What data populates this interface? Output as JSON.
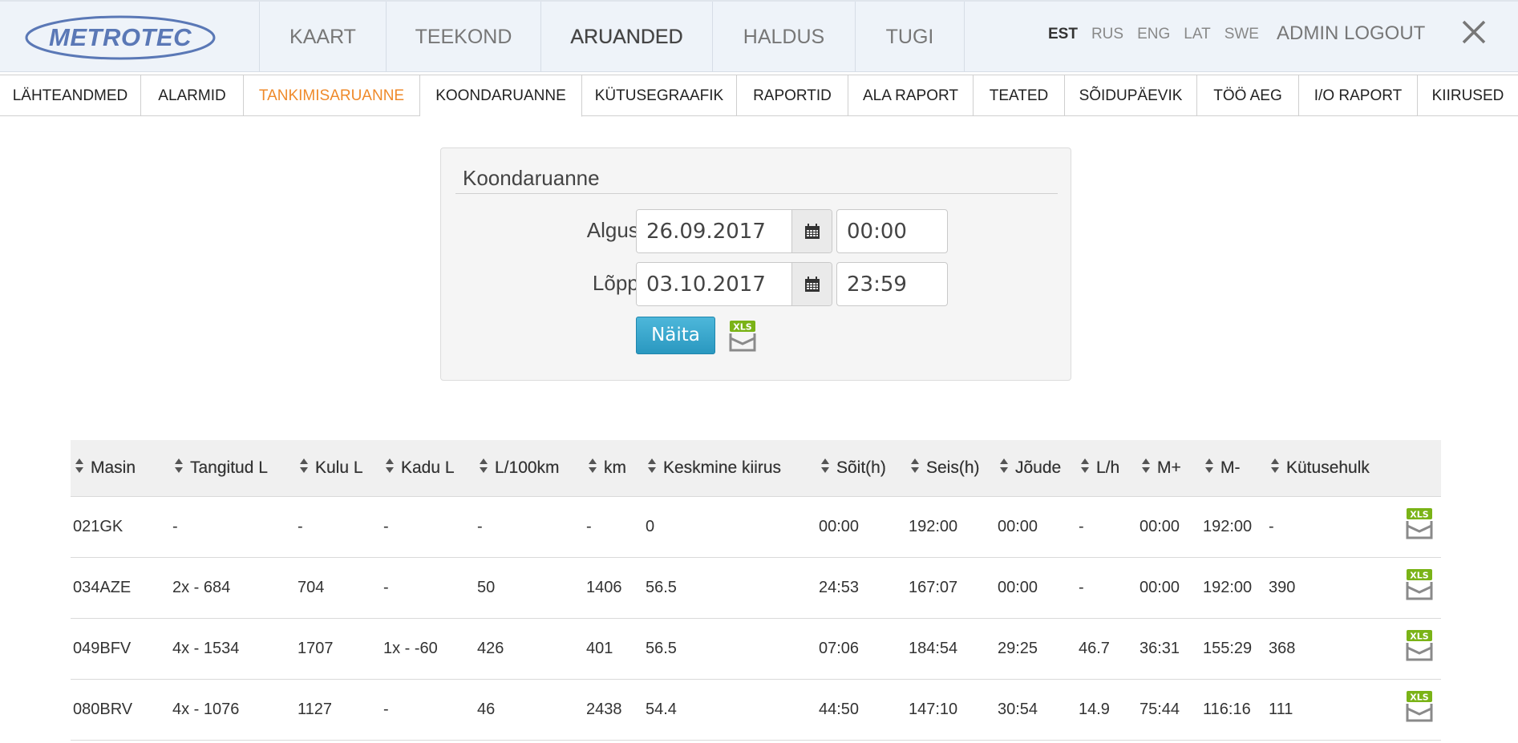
{
  "header": {
    "logo": "METROTEC",
    "nav": [
      "KAART",
      "TEEKOND",
      "ARUANDED",
      "HALDUS",
      "TUGI"
    ],
    "active_nav": "ARUANDED",
    "languages": [
      "EST",
      "RUS",
      "ENG",
      "LAT",
      "SWE"
    ],
    "active_language": "EST",
    "logout_label": "ADMIN LOGOUT",
    "close_icon": "close-icon"
  },
  "subtabs": [
    "LÄHTEANDMED",
    "ALARMID",
    "TANKIMISARUANNE",
    "KOONDARUANNE",
    "KÜTUSEGRAAFIK",
    "RAPORTID",
    "ALA RAPORT",
    "TEATED",
    "SÕIDUPÄEVIK",
    "TÖÖ AEG",
    "I/O RAPORT",
    "KIIRUSED"
  ],
  "active_subtab": "KOONDARUANNE",
  "highlight_subtab": "TANKIMISARUANNE",
  "report_form": {
    "title": "Koondaruanne",
    "start_label": "Algus:",
    "start_date": "26.09.2017",
    "start_time": "00:00",
    "end_label": "Lõpp:",
    "end_date": "03.10.2017",
    "end_time": "23:59",
    "show_button": "Näita",
    "xls_label": "XLS"
  },
  "table": {
    "columns": [
      "Masin",
      "Tangitud L",
      "Kulu L",
      "Kadu L",
      "L/100km",
      "km",
      "Keskmine kiirus",
      "Sõit(h)",
      "Seis(h)",
      "Jõude",
      "L/h",
      "M+",
      "M-",
      "Kütusehulk"
    ],
    "rows": [
      [
        "021GK",
        "-",
        "-",
        "-",
        "-",
        "-",
        "0",
        "00:00",
        "192:00",
        "00:00",
        "-",
        "00:00",
        "192:00",
        "-"
      ],
      [
        "034AZE",
        "2x - 684",
        "704",
        "-",
        "50",
        "1406",
        "56.5",
        "24:53",
        "167:07",
        "00:00",
        "-",
        "00:00",
        "192:00",
        "390"
      ],
      [
        "049BFV",
        "4x - 1534",
        "1707",
        "1x - -60",
        "426",
        "401",
        "56.5",
        "07:06",
        "184:54",
        "29:25",
        "46.7",
        "36:31",
        "155:29",
        "368"
      ],
      [
        "080BRV",
        "4x - 1076",
        "1127",
        "-",
        "46",
        "2438",
        "54.4",
        "44:50",
        "147:10",
        "30:54",
        "14.9",
        "75:44",
        "116:16",
        "111"
      ]
    ]
  },
  "colors": {
    "accent_orange": "#ef8a2a",
    "button_blue": "#2a98c0",
    "logo_blue": "#5a78b6",
    "xls_green": "#7ab317"
  }
}
